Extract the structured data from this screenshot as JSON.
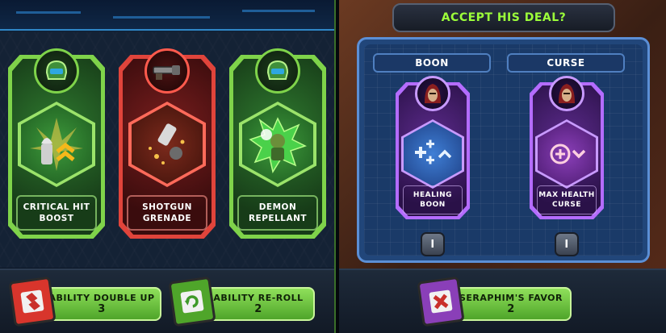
{
  "left": {
    "cards": [
      {
        "label_line1": "CRITICAL HIT",
        "label_line2": "BOOST",
        "color": "green",
        "badge_icon": "helmet-icon",
        "art_icon": "bullet-chevron-icon"
      },
      {
        "label_line1": "SHOTGUN",
        "label_line2": "GRENADE",
        "color": "red",
        "badge_icon": "shotgun-icon",
        "art_icon": "grenade-shell-icon"
      },
      {
        "label_line1": "DEMON",
        "label_line2": "REPELLANT",
        "color": "green",
        "badge_icon": "helmet-icon",
        "art_icon": "demon-slayer-icon"
      }
    ],
    "buttons": [
      {
        "title": "ABILITY DOUBLE UP",
        "count": "3",
        "icon": "double-up-disk-icon"
      },
      {
        "title": "ABILITY RE-ROLL",
        "count": "2",
        "icon": "reroll-disk-icon"
      }
    ]
  },
  "right": {
    "title": "ACCEPT HIS DEAL?",
    "sections": [
      {
        "header": "BOON",
        "label_line1": "HEALING",
        "label_line2": "BOON",
        "icon": "healing-boon-icon",
        "info": "i"
      },
      {
        "header": "CURSE",
        "label_line1": "MAX HEALTH",
        "label_line2": "CURSE",
        "icon": "max-health-curse-icon",
        "info": "i"
      }
    ],
    "button": {
      "title": "SERAPHIM'S FAVOR",
      "count": "2",
      "icon": "seraphim-disk-icon"
    }
  },
  "colors": {
    "green_accent": "#7fd34a",
    "red_accent": "#e0443b",
    "purple_accent": "#b46cff",
    "title_green": "#9cff3a",
    "blue_frame": "#5b8fd6"
  }
}
